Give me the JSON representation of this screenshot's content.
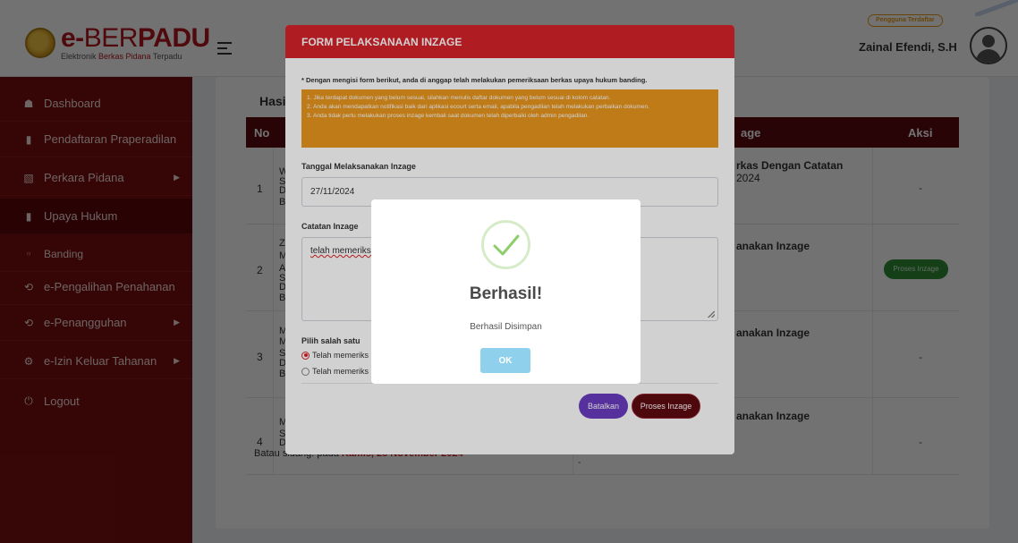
{
  "header": {
    "logo_main_prefix": "e-",
    "logo_main_thin": "BER",
    "logo_main_bold": "PADU",
    "logo_sub_prefix": "Elektronik ",
    "logo_sub_red": "Berkas Pidana",
    "logo_sub_suffix": " Terpadu",
    "role_badge": "Pengguna Terdaftar",
    "user_name": "Zainal Efendi, S.H"
  },
  "sidebar": {
    "items": [
      {
        "label": "Dashboard",
        "icon": "home-icon"
      },
      {
        "label": "Pendaftaran Praperadilan",
        "icon": "document-icon"
      },
      {
        "label": "Perkara Pidana",
        "icon": "folder-icon"
      },
      {
        "label": "Upaya Hukum",
        "icon": "file-icon"
      },
      {
        "label": "Banding",
        "icon": "circle-icon"
      },
      {
        "label": "e-Pengalihan Penahanan",
        "icon": "history-icon"
      },
      {
        "label": "e-Penangguhan",
        "icon": "history-icon"
      },
      {
        "label": "e-Izin Keluar Tahanan",
        "icon": "gear-icon"
      },
      {
        "label": "Logout",
        "icon": "power-icon"
      }
    ]
  },
  "main": {
    "section_title": "Hasi",
    "table": {
      "col_no": "No",
      "col_status": "age",
      "col_aksi": "Aksi",
      "rows": [
        {
          "no": "1",
          "status": "rkas Dengan Catatan",
          "date": "2024",
          "aksi": "-"
        },
        {
          "no": "2",
          "status": "anakan Inzage",
          "aksi_button": "Proses Inzage"
        },
        {
          "no": "3",
          "status": "anakan Inzage",
          "aksi": "-"
        },
        {
          "no": "4",
          "status": "anakan Inzage",
          "aksi": "-"
        }
      ],
      "row_fragments": [
        "W",
        "S",
        "D",
        "B",
        "Z",
        "M",
        "A",
        "S",
        "D",
        "B",
        "M",
        "M",
        "S",
        "D",
        "B",
        "M",
        "S",
        "D"
      ],
      "batas_prefix": "Bata",
      "batas_visible": "u sidang: pada ",
      "batas_date": "Kamis, 28 November 2024",
      "dash_small": "-"
    }
  },
  "form_modal": {
    "title": "FORM PELAKSANAAN INZAGE",
    "note": "* Dengan mengisi form berikut, anda di anggap telah melakukan pemeriksaan berkas upaya hukum banding.",
    "info": [
      "1. Jika terdapat dokumen yang belum sesuai, silahkan menulis daftar dokumen yang belum sesuai di kolom catatan.",
      "2. Anda akan mendapatkan notifikasi baik dari aplikasi ecourt serta email, apabila pengadilan telah melakukan perbaikan dokumen.",
      "3. Anda tidak perlu melakukan proses inzage kembali saat dokumen telah diperbaiki oleh admin pengadilan."
    ],
    "date_label": "Tanggal Melaksanakan Inzage",
    "date_value": "27/11/2024",
    "notes_label": "Catatan Inzage",
    "notes_value": "telah memeriksa",
    "choice_label": "Pilih salah satu",
    "option_1": "Telah memeriks",
    "option_2": "Telah memeriks",
    "btn_cancel": "Batalkan",
    "btn_submit": "Proses Inzage"
  },
  "success_dialog": {
    "title": "Berhasil!",
    "message": "Berhasil Disimpan",
    "ok": "OK"
  },
  "colors": {
    "sidebar": "#7a0d0d",
    "table_header": "#5e0a12",
    "modal_header": "#d6232a",
    "info_box": "#e8961e",
    "ok_button": "#8fd0ec"
  }
}
